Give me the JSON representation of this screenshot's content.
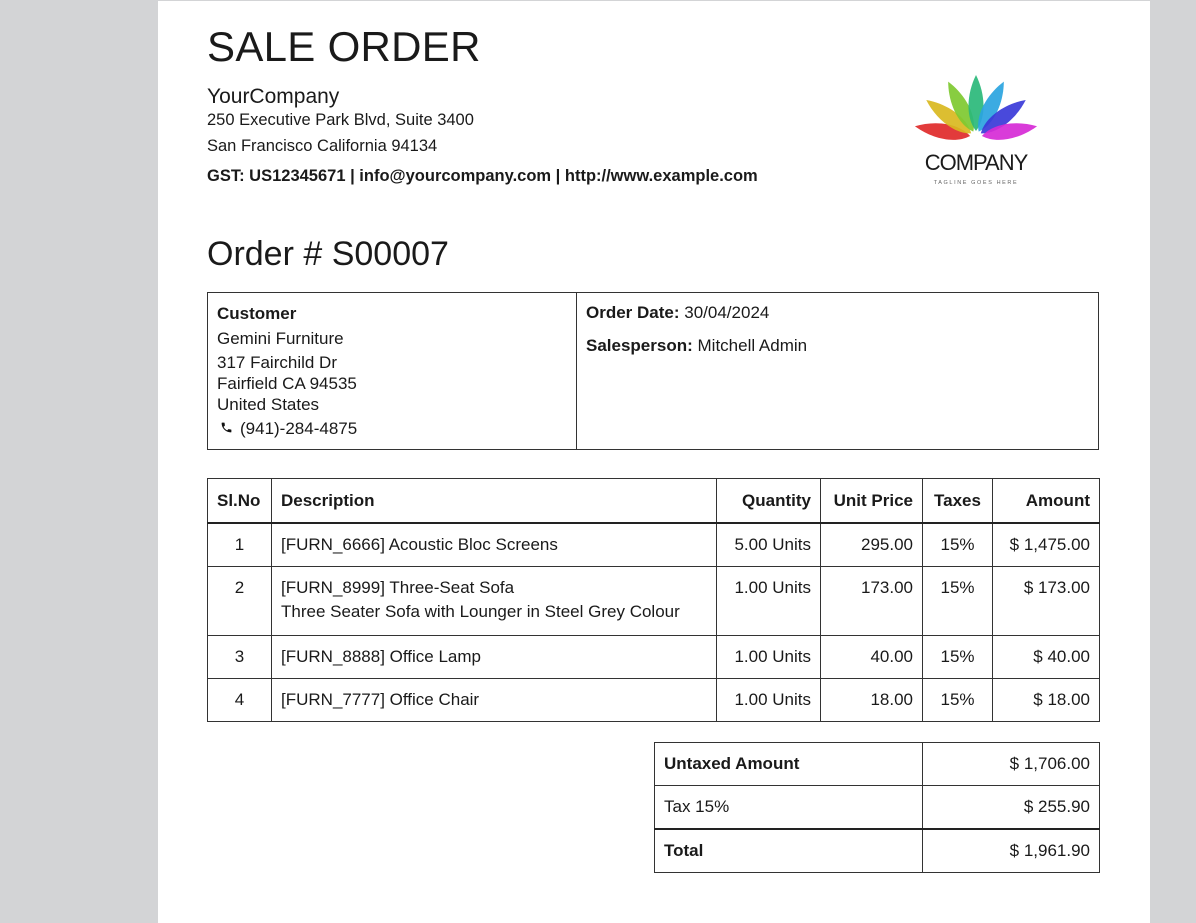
{
  "document": {
    "title": "SALE ORDER",
    "company": {
      "name": "YourCompany",
      "address_line1": "250 Executive Park Blvd, Suite 3400",
      "address_line2": "San Francisco California 94134",
      "contact_line": "GST: US12345671 | info@yourcompany.com | http://www.example.com"
    },
    "logo": {
      "text": "COMPANY",
      "tagline": "TAGLINE GOES HERE",
      "petal_colors": [
        "#e02a2a",
        "#d9b81f",
        "#7ec930",
        "#2ab97a",
        "#2aa4e0",
        "#3a3ad8",
        "#d62ad6"
      ]
    },
    "order_title": "Order # S00007",
    "customer": {
      "label": "Customer",
      "name": "Gemini Furniture",
      "street": "317 Fairchild Dr",
      "city_line": "Fairfield CA 94535",
      "country": "United States",
      "phone": "(941)-284-4875"
    },
    "order_info": {
      "date_label": "Order Date:",
      "date_value": "30/04/2024",
      "salesperson_label": "Salesperson:",
      "salesperson_value": "Mitchell Admin"
    },
    "lines": {
      "headers": [
        "Sl.No",
        "Description",
        "Quantity",
        "Unit Price",
        "Taxes",
        "Amount"
      ],
      "rows": [
        {
          "no": "1",
          "desc": "[FURN_6666] Acoustic Bloc Screens",
          "desc2": "",
          "qty": "5.00 Units",
          "price": "295.00",
          "tax": "15%",
          "amount": "$ 1,475.00"
        },
        {
          "no": "2",
          "desc": "[FURN_8999] Three-Seat Sofa",
          "desc2": "Three Seater Sofa with Lounger in Steel Grey Colour",
          "qty": "1.00 Units",
          "price": "173.00",
          "tax": "15%",
          "amount": "$ 173.00"
        },
        {
          "no": "3",
          "desc": "[FURN_8888] Office Lamp",
          "desc2": "",
          "qty": "1.00 Units",
          "price": "40.00",
          "tax": "15%",
          "amount": "$ 40.00"
        },
        {
          "no": "4",
          "desc": "[FURN_7777] Office Chair",
          "desc2": "",
          "qty": "1.00 Units",
          "price": "18.00",
          "tax": "15%",
          "amount": "$ 18.00"
        }
      ]
    },
    "totals": {
      "untaxed_label": "Untaxed Amount",
      "untaxed_value": "$ 1,706.00",
      "tax_label": "Tax 15%",
      "tax_value": "$ 255.90",
      "total_label": "Total",
      "total_value": "$ 1,961.90"
    }
  }
}
